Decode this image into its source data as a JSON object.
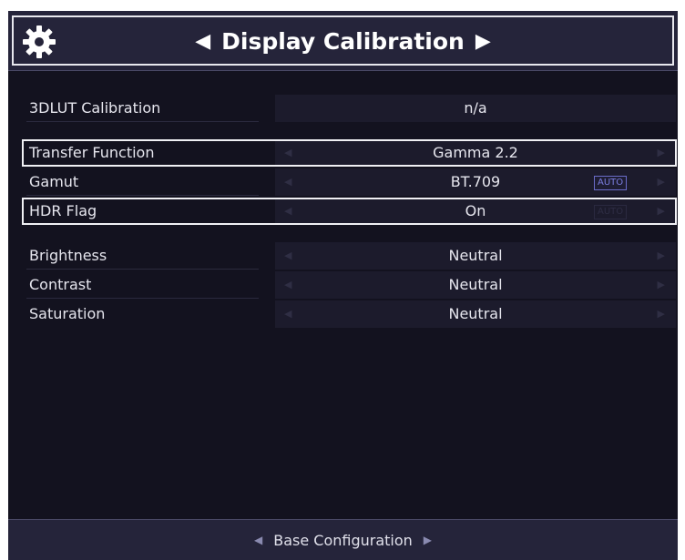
{
  "header": {
    "title": "Display Calibration",
    "prev_arrow": "◀",
    "next_arrow": "▶",
    "icon": "gear-icon"
  },
  "rows": [
    {
      "label": "3DLUT Calibration",
      "value": "n/a",
      "has_arrows": false,
      "auto_badge": ""
    },
    {
      "label": "Transfer Function",
      "value": "Gamma 2.2",
      "has_arrows": true,
      "auto_badge": "",
      "selected": true
    },
    {
      "label": "Gamut",
      "value": "BT.709",
      "has_arrows": true,
      "auto_badge": "AUTO",
      "auto_active": true
    },
    {
      "label": "HDR Flag",
      "value": "On",
      "has_arrows": true,
      "auto_badge": "AUTO",
      "auto_active": false,
      "selected": true
    },
    {
      "label": "Brightness",
      "value": "Neutral",
      "has_arrows": true,
      "auto_badge": ""
    },
    {
      "label": "Contrast",
      "value": "Neutral",
      "has_arrows": true,
      "auto_badge": ""
    },
    {
      "label": "Saturation",
      "value": "Neutral",
      "has_arrows": true,
      "auto_badge": ""
    }
  ],
  "footer": {
    "label": "Base Configuration",
    "prev_arrow": "◀",
    "next_arrow": "▶"
  },
  "colors": {
    "background": "#13121f",
    "header": "#25243a",
    "field": "#1c1b2c",
    "highlight": "#f0f0f4",
    "auto_badge": "#6a6cc8"
  }
}
